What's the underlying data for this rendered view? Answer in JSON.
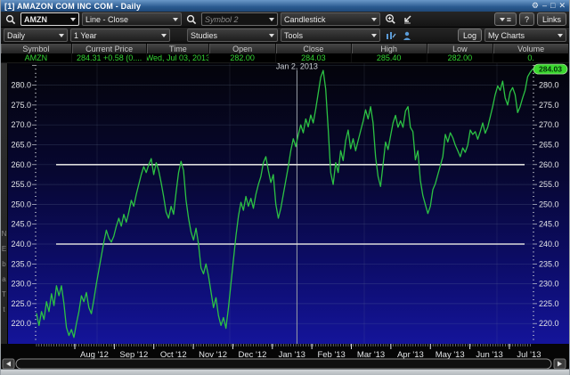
{
  "window": {
    "title": "[1] AMAZON COM INC COM - Daily",
    "controls": [
      "settings-icon",
      "minimize-icon",
      "maximize-icon",
      "close-icon"
    ]
  },
  "toolbar1": {
    "symbol": "AMZN",
    "chart_type": "Line - Close",
    "symbol2_placeholder": "Symbol 2",
    "overlay_type": "Candlestick",
    "icons": [
      "search-icon",
      "search-icon",
      "zoom-in-icon",
      "zoom-reset-icon"
    ],
    "help_label": "?",
    "links_label": "Links"
  },
  "toolbar2": {
    "period": "Daily",
    "range": "1 Year",
    "studies": "Studies",
    "tools": "Tools",
    "icons": [
      "pattern-icon",
      "alerts-icon"
    ],
    "log_label": "Log",
    "my_charts": "My Charts"
  },
  "quote": {
    "headers": [
      "Symbol",
      "Current Price",
      "Time",
      "Open",
      "Close",
      "High",
      "Low",
      "Volume"
    ],
    "values": [
      "AMZN",
      "284.31  +0.58 (0....",
      "Wed, Jul 03, 2013",
      "282.00",
      "284.03",
      "285.40",
      "282.00",
      "0."
    ]
  },
  "side_strip": {
    "chars": [
      "N",
      "E",
      "b",
      "a",
      "T",
      "t"
    ]
  },
  "chart_data": {
    "type": "line",
    "symbol": "AMZN",
    "x_labels": [
      "Aug '12",
      "Sep '12",
      "Oct '12",
      "Nov '12",
      "Dec '12",
      "Jan '13",
      "Feb '13",
      "Mar '13",
      "Apr '13",
      "May '13",
      "Jun '13",
      "Jul '13"
    ],
    "y_axis": {
      "min": 220,
      "max": 280,
      "tick_step": 5,
      "minor_step": 1,
      "label_decimals": 1
    },
    "drawn_hlines": [
      260.0,
      240.0
    ],
    "annotation": {
      "label": "Jan 2, 2013",
      "x_fraction": 0.525
    },
    "last_price_label": "284.03",
    "series": [
      {
        "name": "AMZN Close",
        "values": [
          222.5,
          219.5,
          223,
          221,
          225.5,
          223,
          227.5,
          224.5,
          229.5,
          227,
          229.5,
          225,
          219,
          217,
          218.5,
          216.5,
          220,
          223,
          227,
          225.5,
          227.8,
          224,
          222.5,
          226,
          230,
          233.5,
          237,
          240.5,
          243.5,
          241.5,
          240.5,
          242,
          244.5,
          246.5,
          244.5,
          247.5,
          245.5,
          248,
          251,
          249.5,
          252.5,
          255,
          257.5,
          259.5,
          258,
          260,
          261.5,
          257.5,
          260.5,
          258.5,
          255.5,
          252,
          248,
          246.5,
          249.5,
          247.5,
          253,
          258,
          260.8,
          258.5,
          251,
          246.5,
          243,
          241,
          244,
          240,
          234,
          232.5,
          235,
          232,
          228,
          224,
          226.5,
          222,
          219.5,
          221.5,
          218.8,
          224,
          230,
          236,
          242,
          247,
          250.5,
          248.5,
          252,
          249.5,
          251.5,
          249,
          252.5,
          255,
          257,
          260.5,
          262,
          258.5,
          255.5,
          257.5,
          250,
          246.5,
          249,
          252.5,
          256,
          259.5,
          263.5,
          266.5,
          264.5,
          267.5,
          270,
          268,
          271.5,
          269.5,
          272.5,
          270.5,
          274,
          278,
          282,
          283.7,
          279,
          269,
          258,
          255,
          260.5,
          258,
          263.5,
          261,
          266,
          268.7,
          264,
          266.5,
          263.5,
          266,
          268.5,
          270.9,
          273.8,
          271.5,
          274.6,
          270.5,
          262,
          257,
          254.5,
          260,
          265.7,
          263.8,
          267.2,
          270.5,
          272.4,
          269.4,
          271,
          269.4,
          273.5,
          274.6,
          269.4,
          268.3,
          261.2,
          263.5,
          256,
          252.2,
          249.9,
          247.7,
          249.5,
          253.7,
          255.2,
          257.5,
          259.7,
          262,
          267.6,
          265.7,
          268,
          266.8,
          264.9,
          263.5,
          262,
          264.2,
          263.1,
          264.9,
          268.7,
          267.6,
          268.3,
          266.4,
          268.3,
          270.5,
          267.9,
          269.4,
          272,
          274.6,
          277.6,
          279.8,
          278.7,
          281,
          276.8,
          275,
          278.3,
          279.4,
          277.6,
          273.1,
          274.6,
          276.8,
          278.7,
          282.1,
          283.2,
          284.03
        ]
      }
    ],
    "grid": {
      "horizontal": true,
      "vertical_quarterly": true
    },
    "colors": {
      "line": "#2cc244",
      "bubble": "#3bd82f",
      "drawn_line": "#dcdcdc",
      "bg_top": "#04040a",
      "bg_bottom": "#14149a",
      "quote_green": "#33d433"
    }
  }
}
